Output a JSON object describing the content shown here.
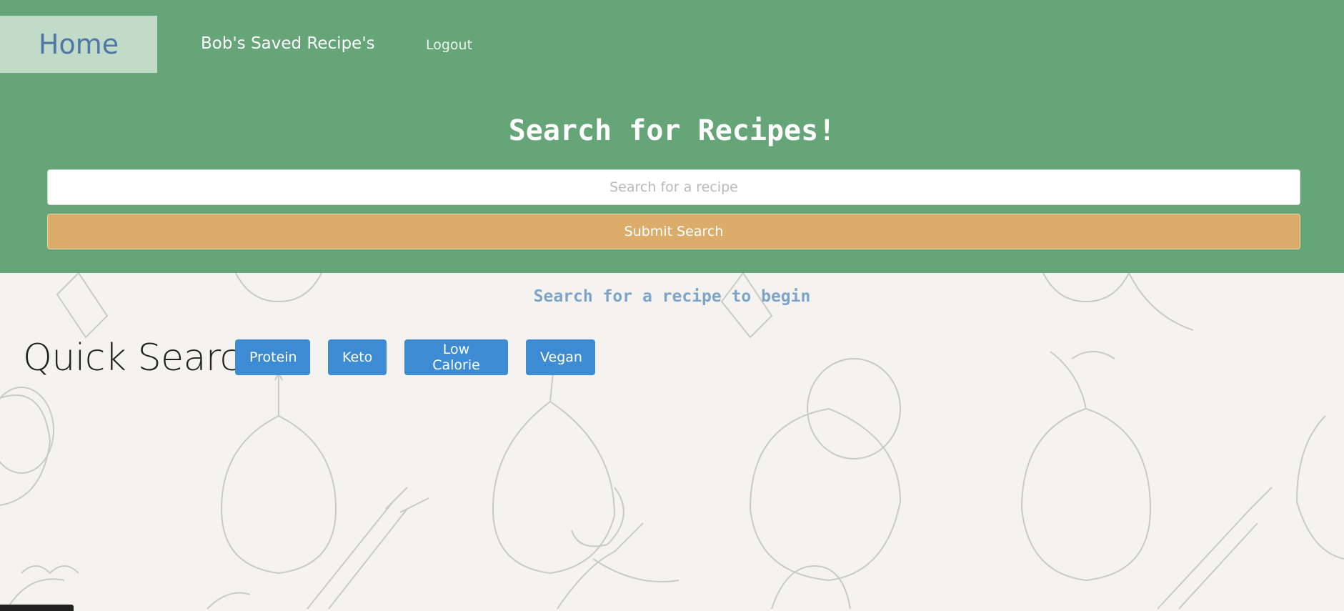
{
  "nav": {
    "home_label": "Home",
    "saved_label": "Bob's Saved Recipe's",
    "logout_label": "Logout"
  },
  "search": {
    "title": "Search for Recipes!",
    "placeholder": "Search for a recipe",
    "value": "",
    "submit_label": "Submit Search"
  },
  "results": {
    "empty_message": "Search for a recipe to begin"
  },
  "quick_search": {
    "label": "Quick Search:",
    "buttons": [
      "Protein",
      "Keto",
      "Low Calorie",
      "Vegan"
    ]
  },
  "colors": {
    "header_bg": "#65a577",
    "home_tab_bg": "#c2dbc8",
    "submit_bg": "#dbac6a",
    "quick_button_bg": "#3c8bd3",
    "page_bg": "#f4f3ef"
  }
}
